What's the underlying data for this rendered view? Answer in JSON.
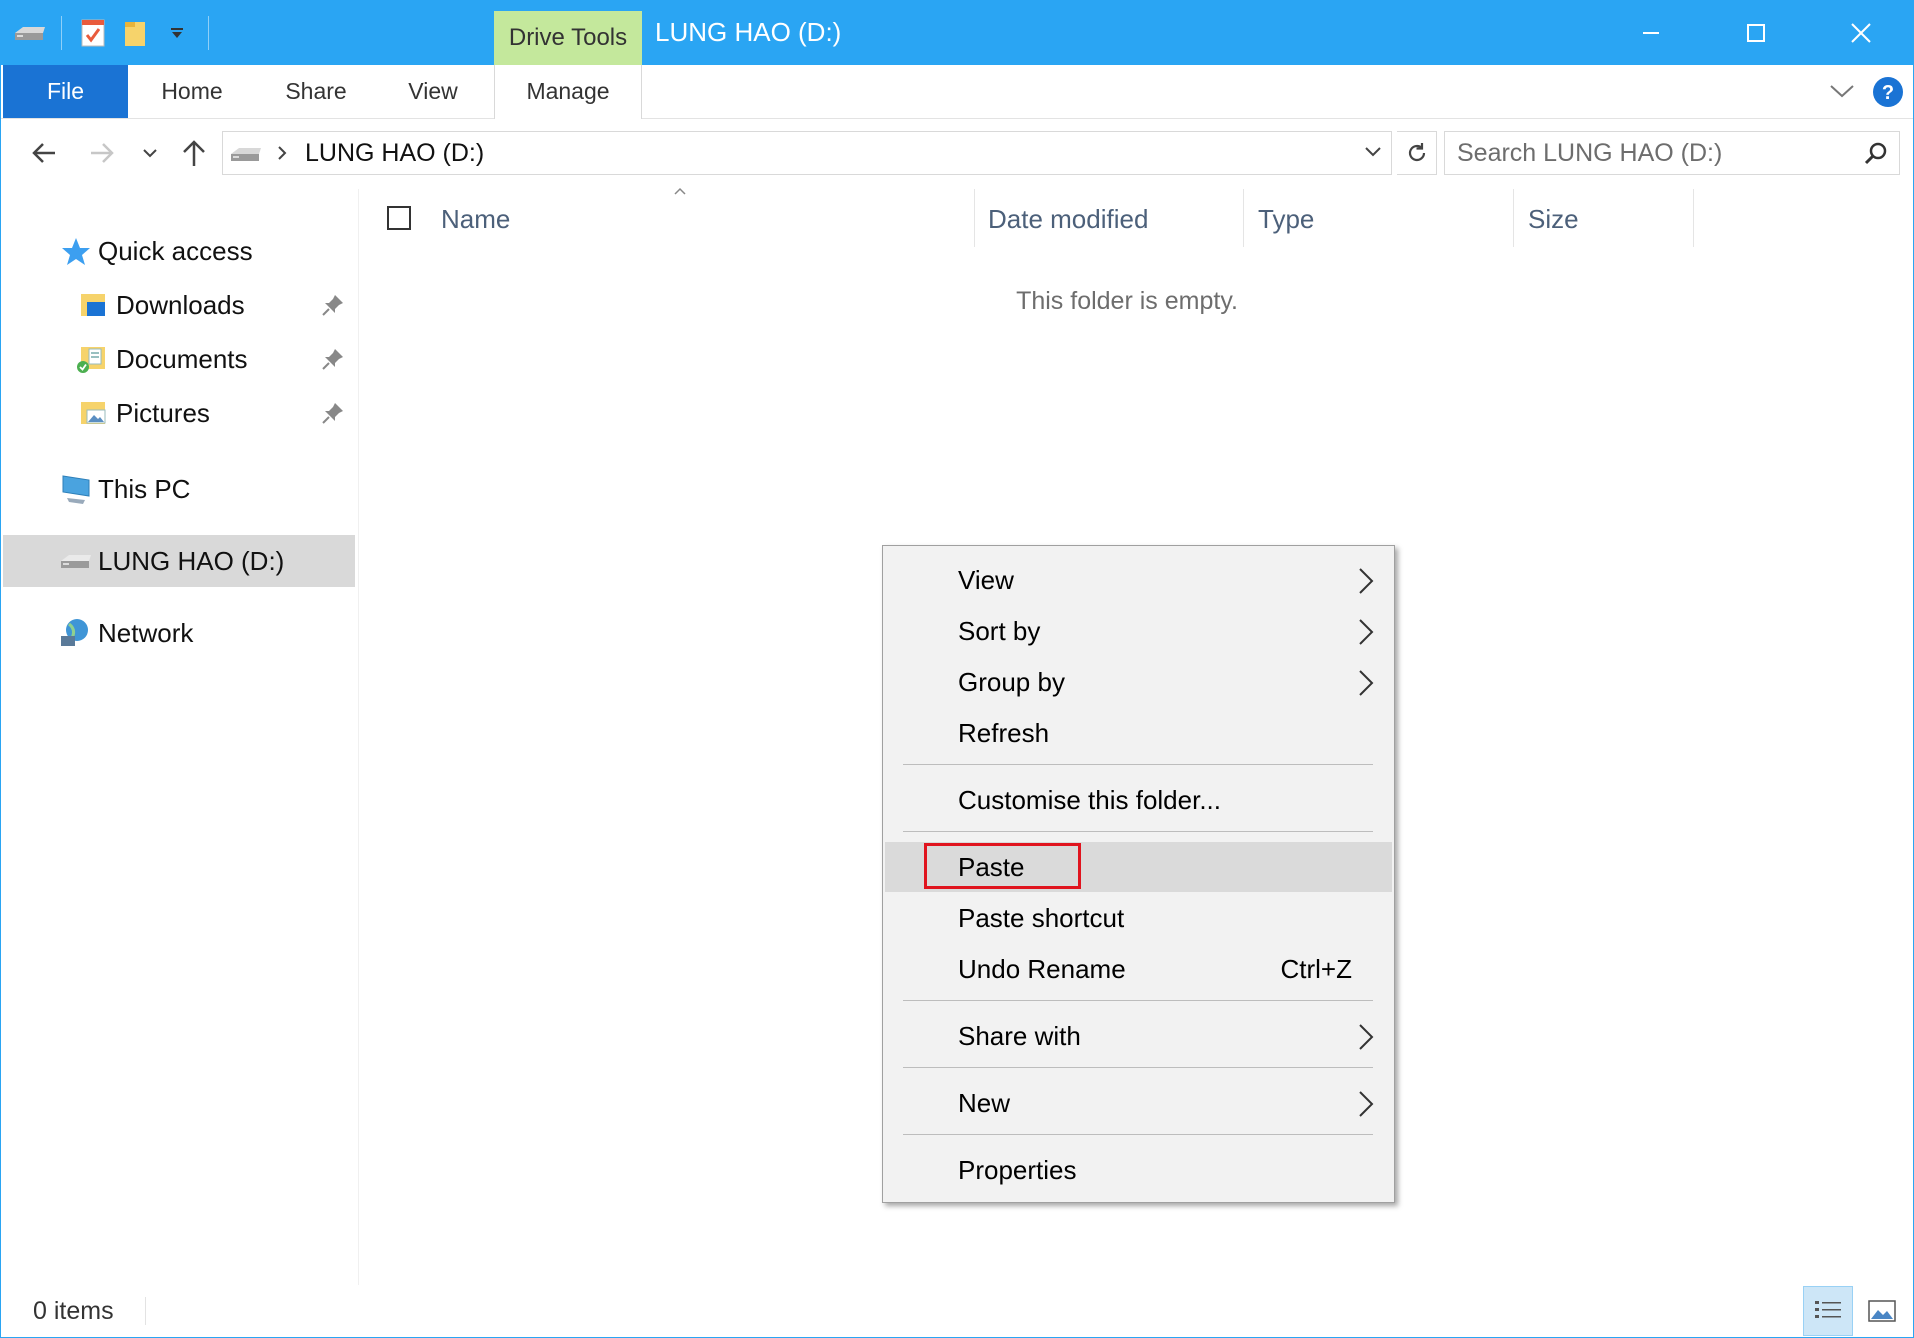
{
  "window": {
    "title": "LUNG HAO (D:)",
    "context_tab": "Drive Tools",
    "accent_color": "#2aa5f3",
    "file_tab_color": "#1a73d4"
  },
  "ribbon": {
    "tabs": [
      "File",
      "Home",
      "Share",
      "View",
      "Manage"
    ]
  },
  "address": {
    "path": "LUNG HAO (D:)",
    "search_placeholder": "Search LUNG HAO (D:)"
  },
  "nav": {
    "quick_access": "Quick access",
    "pinned": [
      {
        "label": "Downloads"
      },
      {
        "label": "Documents"
      },
      {
        "label": "Pictures"
      }
    ],
    "this_pc": "This PC",
    "drive": "LUNG HAO (D:)",
    "network": "Network"
  },
  "columns": [
    "Name",
    "Date modified",
    "Type",
    "Size"
  ],
  "empty_message": "This folder is empty.",
  "status": {
    "items": "0 items"
  },
  "context_menu": {
    "items": [
      {
        "label": "View",
        "submenu": true
      },
      {
        "label": "Sort by",
        "submenu": true
      },
      {
        "label": "Group by",
        "submenu": true
      },
      {
        "label": "Refresh"
      },
      {
        "label": "Customise this folder..."
      },
      {
        "label": "Paste",
        "highlighted": true
      },
      {
        "label": "Paste shortcut"
      },
      {
        "label": "Undo Rename",
        "shortcut": "Ctrl+Z"
      },
      {
        "label": "Share with",
        "submenu": true
      },
      {
        "label": "New",
        "submenu": true
      },
      {
        "label": "Properties"
      }
    ]
  }
}
